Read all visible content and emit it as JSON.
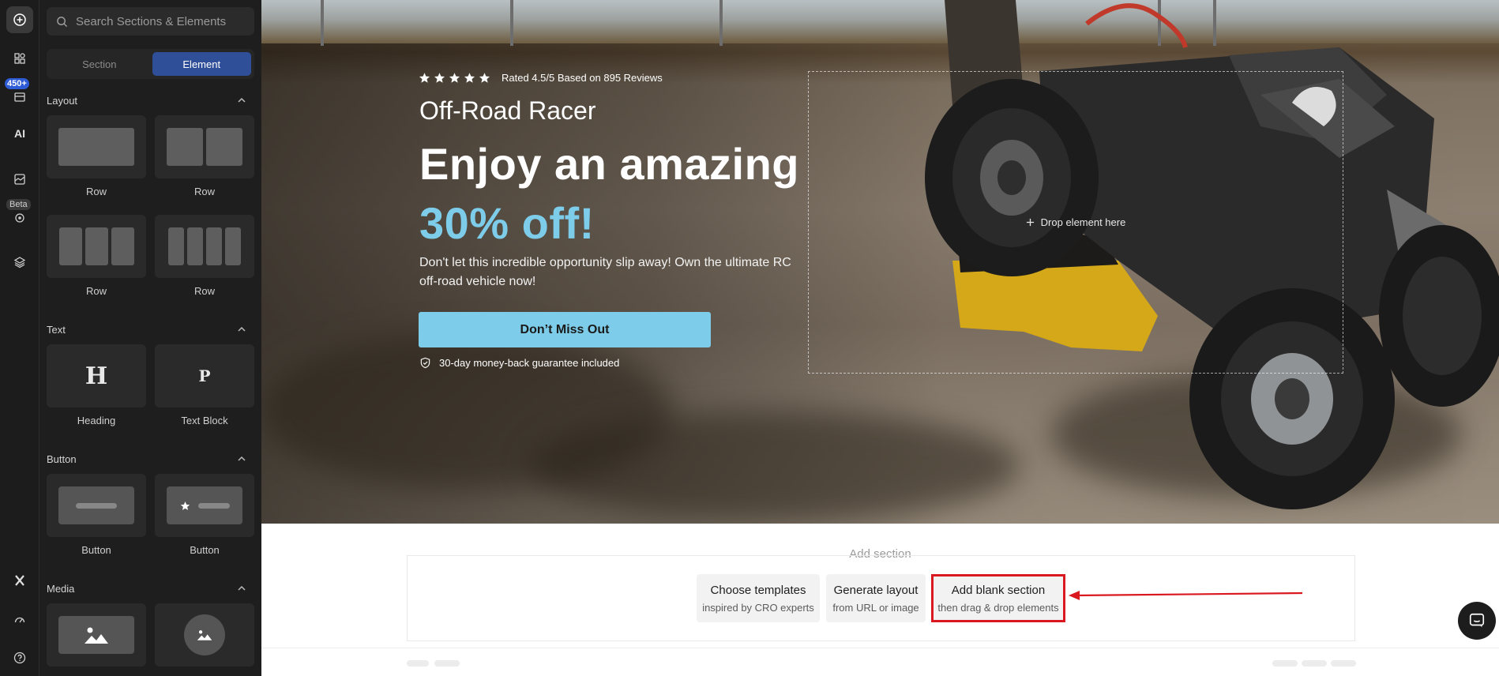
{
  "rail": {
    "items": [
      {
        "name": "add-icon",
        "active": true
      },
      {
        "name": "templates-icon"
      },
      {
        "name": "library-icon"
      },
      {
        "name": "ai-icon"
      },
      {
        "name": "pages-icon"
      },
      {
        "name": "target-icon"
      },
      {
        "name": "layers-icon"
      },
      {
        "name": "x-logo-icon"
      },
      {
        "name": "speed-icon"
      },
      {
        "name": "help-icon"
      }
    ],
    "library_badge": "450+",
    "beta_badge": "Beta",
    "ai_label": "AI"
  },
  "panel": {
    "search_placeholder": "Search Sections & Elements",
    "tabs": [
      {
        "label": "Section",
        "active": false
      },
      {
        "label": "Element",
        "active": true
      }
    ],
    "groups": {
      "layout": {
        "title": "Layout",
        "items": [
          "Row",
          "Row",
          "Row",
          "Row"
        ]
      },
      "text": {
        "title": "Text",
        "items": [
          "Heading",
          "Text Block"
        ],
        "heading_glyph": "H",
        "text_glyph": "P"
      },
      "button": {
        "title": "Button",
        "items": [
          "Button",
          "Button"
        ]
      },
      "media": {
        "title": "Media",
        "items": []
      }
    }
  },
  "hero": {
    "rating": "Rated 4.5/5 Based on 895 Reviews",
    "stars": 5,
    "kicker": "Off-Road Racer",
    "headline": "Enjoy an amazing",
    "offer": "30% off!",
    "description": "Don't let this incredible opportunity slip away! Own the ultimate RC off-road vehicle now!",
    "cta_label": "Don’t Miss Out",
    "guarantee": "30-day money-back guarantee included",
    "drop_hint": "Drop element here",
    "accent_color": "#7dcdea"
  },
  "add_section": {
    "title": "Add section",
    "cards": [
      {
        "title": "Choose templates",
        "subtitle": "inspired by CRO experts"
      },
      {
        "title": "Generate layout",
        "subtitle": "from URL or image"
      },
      {
        "title": "Add blank section",
        "subtitle": "then drag & drop elements",
        "highlighted": true
      }
    ],
    "highlight_color": "#d9191f"
  }
}
